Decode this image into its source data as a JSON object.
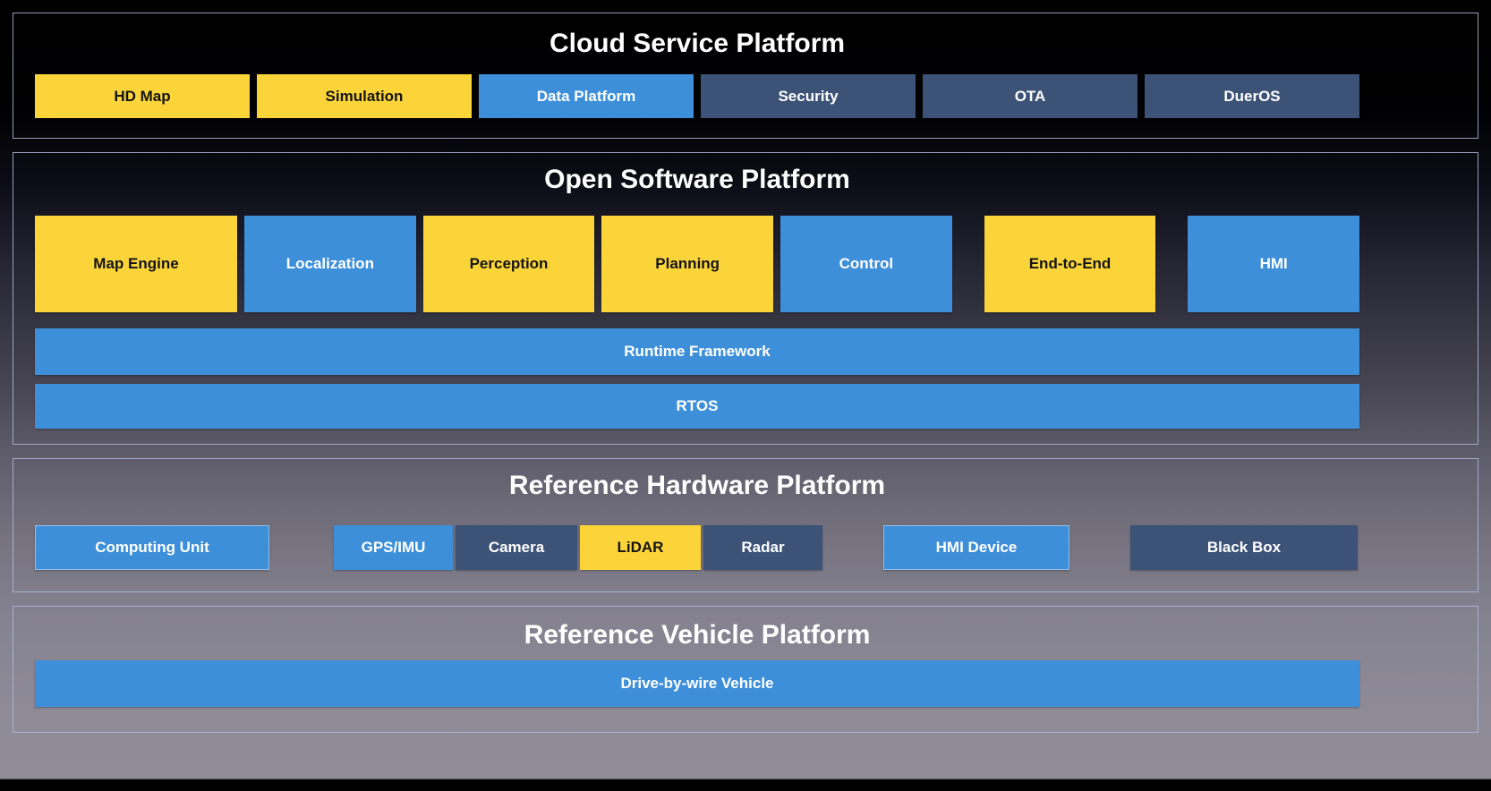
{
  "colors": {
    "yellow": "#FBD43A",
    "blue": "#3E8FD9",
    "navy": "#3C5377",
    "section_border": "#AEB9DC",
    "title_text": "#FFFFFF"
  },
  "cloud": {
    "title": "Cloud Service Platform",
    "items": [
      {
        "label": "HD Map",
        "color": "yellow"
      },
      {
        "label": "Simulation",
        "color": "yellow"
      },
      {
        "label": "Data Platform",
        "color": "blue"
      },
      {
        "label": "Security",
        "color": "navy"
      },
      {
        "label": "OTA",
        "color": "navy"
      },
      {
        "label": "DuerOS",
        "color": "navy"
      }
    ]
  },
  "software": {
    "title": "Open Software Platform",
    "modules": [
      {
        "label": "Map Engine",
        "color": "yellow"
      },
      {
        "label": "Localization",
        "color": "blue"
      },
      {
        "label": "Perception",
        "color": "yellow"
      },
      {
        "label": "Planning",
        "color": "yellow"
      },
      {
        "label": "Control",
        "color": "blue"
      },
      {
        "label": "End-to-End",
        "color": "yellow"
      },
      {
        "label": "HMI",
        "color": "blue"
      }
    ],
    "runtime": {
      "label": "Runtime Framework",
      "color": "blue"
    },
    "rtos": {
      "label": "RTOS",
      "color": "blue"
    }
  },
  "hardware": {
    "title": "Reference Hardware Platform",
    "items": [
      {
        "label": "Computing Unit",
        "color": "blue"
      },
      {
        "label": "GPS/IMU",
        "color": "blue"
      },
      {
        "label": "Camera",
        "color": "navy"
      },
      {
        "label": "LiDAR",
        "color": "yellow"
      },
      {
        "label": "Radar",
        "color": "navy"
      },
      {
        "label": "HMI Device",
        "color": "blue"
      },
      {
        "label": "Black Box",
        "color": "navy"
      }
    ]
  },
  "vehicle": {
    "title": "Reference Vehicle Platform",
    "item": {
      "label": "Drive-by-wire Vehicle",
      "color": "blue"
    }
  }
}
